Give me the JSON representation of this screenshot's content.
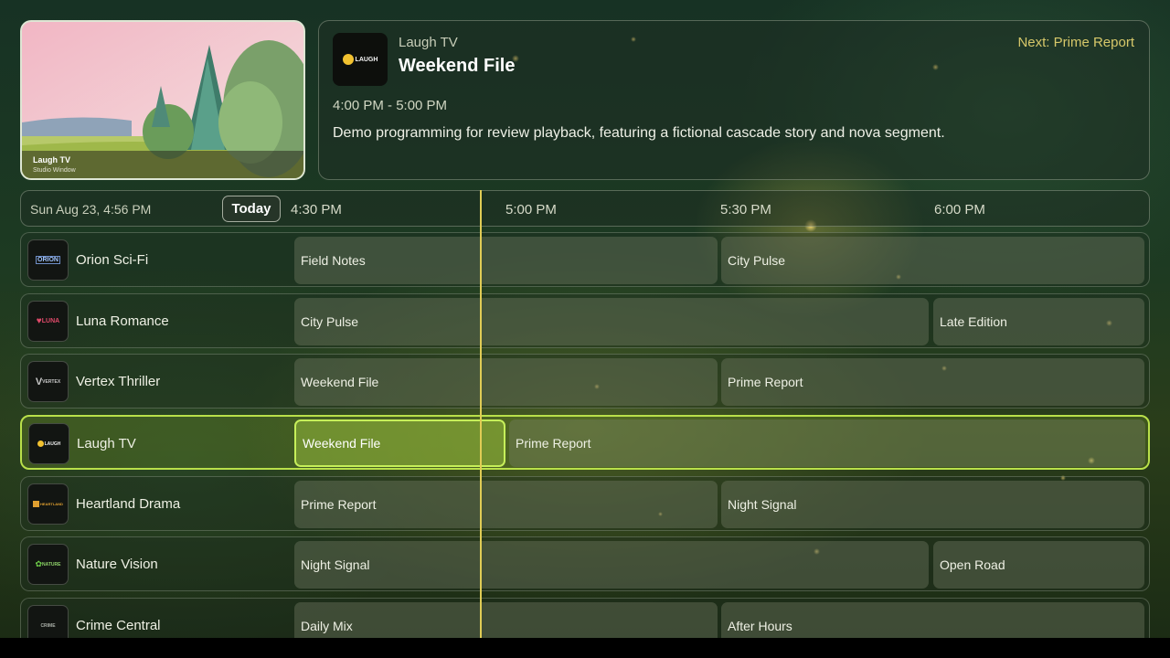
{
  "preview": {
    "channel": "Laugh TV",
    "subtitle": "Studio Window"
  },
  "info": {
    "logo_icon": "laugh-tv-logo",
    "logo_text": "LAUGH",
    "channel": "Laugh TV",
    "title": "Weekend File",
    "next": "Next: Prime Report",
    "time": "4:00 PM - 5:00 PM",
    "description": "Demo programming for review playback, featuring a fictional cascade story and nova segment."
  },
  "timebar": {
    "date": "Sun Aug 23, 4:56 PM",
    "today": "Today",
    "ticks": [
      "4:30 PM",
      "5:00 PM",
      "5:30 PM",
      "6:00 PM"
    ]
  },
  "colors": {
    "accent": "#c6ef5a",
    "now_line": "#e0cc55",
    "next_text": "#d7c86a"
  },
  "rows": [
    {
      "channel": "Orion Sci-Fi",
      "logo": "ORION",
      "programs": [
        "Field Notes",
        "City Pulse"
      ]
    },
    {
      "channel": "Luna Romance",
      "logo": "LUNA",
      "programs": [
        "City Pulse",
        "Late Edition"
      ]
    },
    {
      "channel": "Vertex Thriller",
      "logo": "VERTEX",
      "programs": [
        "Weekend File",
        "Prime Report"
      ]
    },
    {
      "channel": "Laugh TV",
      "logo": "LAUGH",
      "programs": [
        "Weekend File",
        "Prime Report"
      ]
    },
    {
      "channel": "Heartland Drama",
      "logo": "HEARTLAND",
      "programs": [
        "Prime Report",
        "Night Signal"
      ]
    },
    {
      "channel": "Nature Vision",
      "logo": "NATURE",
      "programs": [
        "Night Signal",
        "Open Road"
      ]
    },
    {
      "channel": "Crime Central",
      "logo": "CRIME",
      "programs": [
        "Daily Mix",
        "After Hours"
      ]
    }
  ]
}
